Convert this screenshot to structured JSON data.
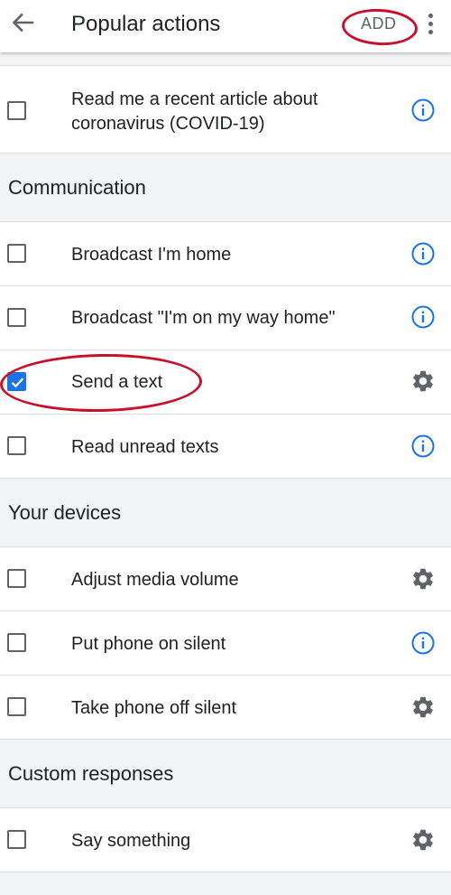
{
  "appbar": {
    "title": "Popular actions",
    "add_label": "ADD"
  },
  "colors": {
    "accent": "#1a73e8",
    "highlight": "#c8102e",
    "section_bg": "#f1f3f4",
    "divider": "#dadce0"
  },
  "rows": [
    {
      "label_line1": "Read me a recent article about",
      "label_line2": "coronavirus (COVID-19)",
      "checked": false,
      "icon": "info-icon"
    },
    {
      "label": "Broadcast I'm home",
      "checked": false,
      "icon": "info-icon"
    },
    {
      "label": "Broadcast \"I'm on my way home\"",
      "checked": false,
      "icon": "info-icon"
    },
    {
      "label": "Send a text",
      "checked": true,
      "icon": "gear-icon"
    },
    {
      "label": "Read unread texts",
      "checked": false,
      "icon": "info-icon"
    },
    {
      "label": "Adjust media volume",
      "checked": false,
      "icon": "gear-icon"
    },
    {
      "label": "Put phone on silent",
      "checked": false,
      "icon": "info-icon"
    },
    {
      "label": "Take phone off silent",
      "checked": false,
      "icon": "gear-icon"
    },
    {
      "label": "Say something",
      "checked": false,
      "icon": "gear-icon"
    }
  ],
  "sections": {
    "communication": "Communication",
    "your_devices": "Your devices",
    "custom_responses": "Custom responses"
  }
}
